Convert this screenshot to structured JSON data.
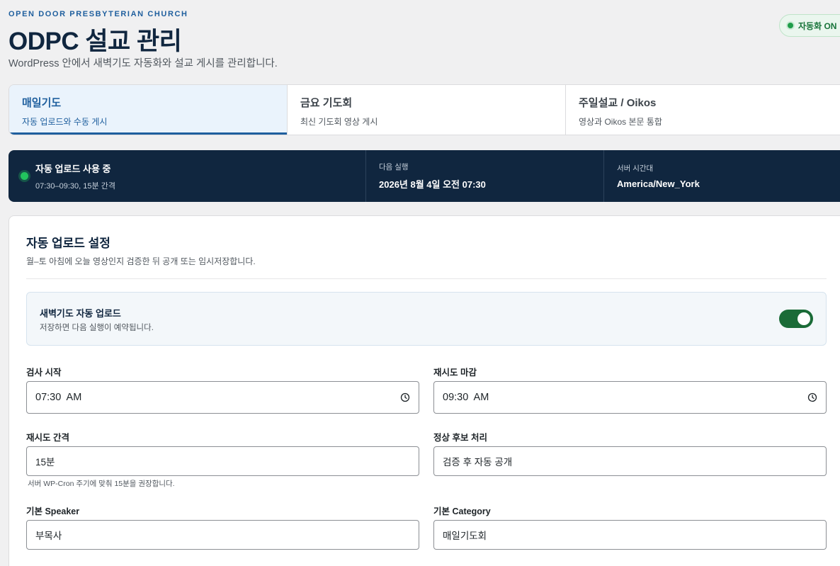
{
  "header": {
    "eyebrow": "OPEN DOOR PRESBYTERIAN CHURCH",
    "title": "ODPC 설교 관리",
    "subtitle": "WordPress 안에서 새벽기도 자동화와 설교 게시를 관리합니다.",
    "status_badge": "자동화 ON"
  },
  "tabs": [
    {
      "label": "매일기도",
      "desc": "자동 업로드와 수동 게시"
    },
    {
      "label": "금요 기도회",
      "desc": "최신 기도회 영상 게시"
    },
    {
      "label": "주일설교 / Oikos",
      "desc": "영상과 Oikos 본문 통합"
    }
  ],
  "banner": {
    "status": "자동 업로드 사용 중",
    "schedule": "07:30–09:30, 15분 간격",
    "next_label": "다음 실행",
    "next_value": "2026년 8월 4일 오전 07:30",
    "tz_label": "서버 시간대",
    "tz_value": "America/New_York"
  },
  "settings": {
    "title": "자동 업로드 설정",
    "desc": "월–토 아침에 오늘 영상인지 검증한 뒤 공개 또는 임시저장합니다.",
    "toggle_title": "새벽기도 자동 업로드",
    "toggle_desc": "저장하면 다음 실행이 예약됩니다.",
    "toggle_on": true,
    "fields": {
      "start_label": "검사 시작",
      "start_value": "07:30  AM",
      "end_label": "재시도 마감",
      "end_value": "09:30  AM",
      "interval_label": "재시도 간격",
      "interval_value": "15분",
      "interval_hint": "서버 WP-Cron 주기에 맞춰 15분을 권장합니다.",
      "normal_label": "정상 후보 처리",
      "normal_value": "검증 후 자동 공개",
      "speaker_label": "기본 Speaker",
      "speaker_value": "부목사",
      "category_label": "기본 Category",
      "category_value": "매일기도회"
    }
  },
  "colors": {
    "brand": "#1f5f9e",
    "navy": "#10263f",
    "success": "#1a6b37"
  }
}
